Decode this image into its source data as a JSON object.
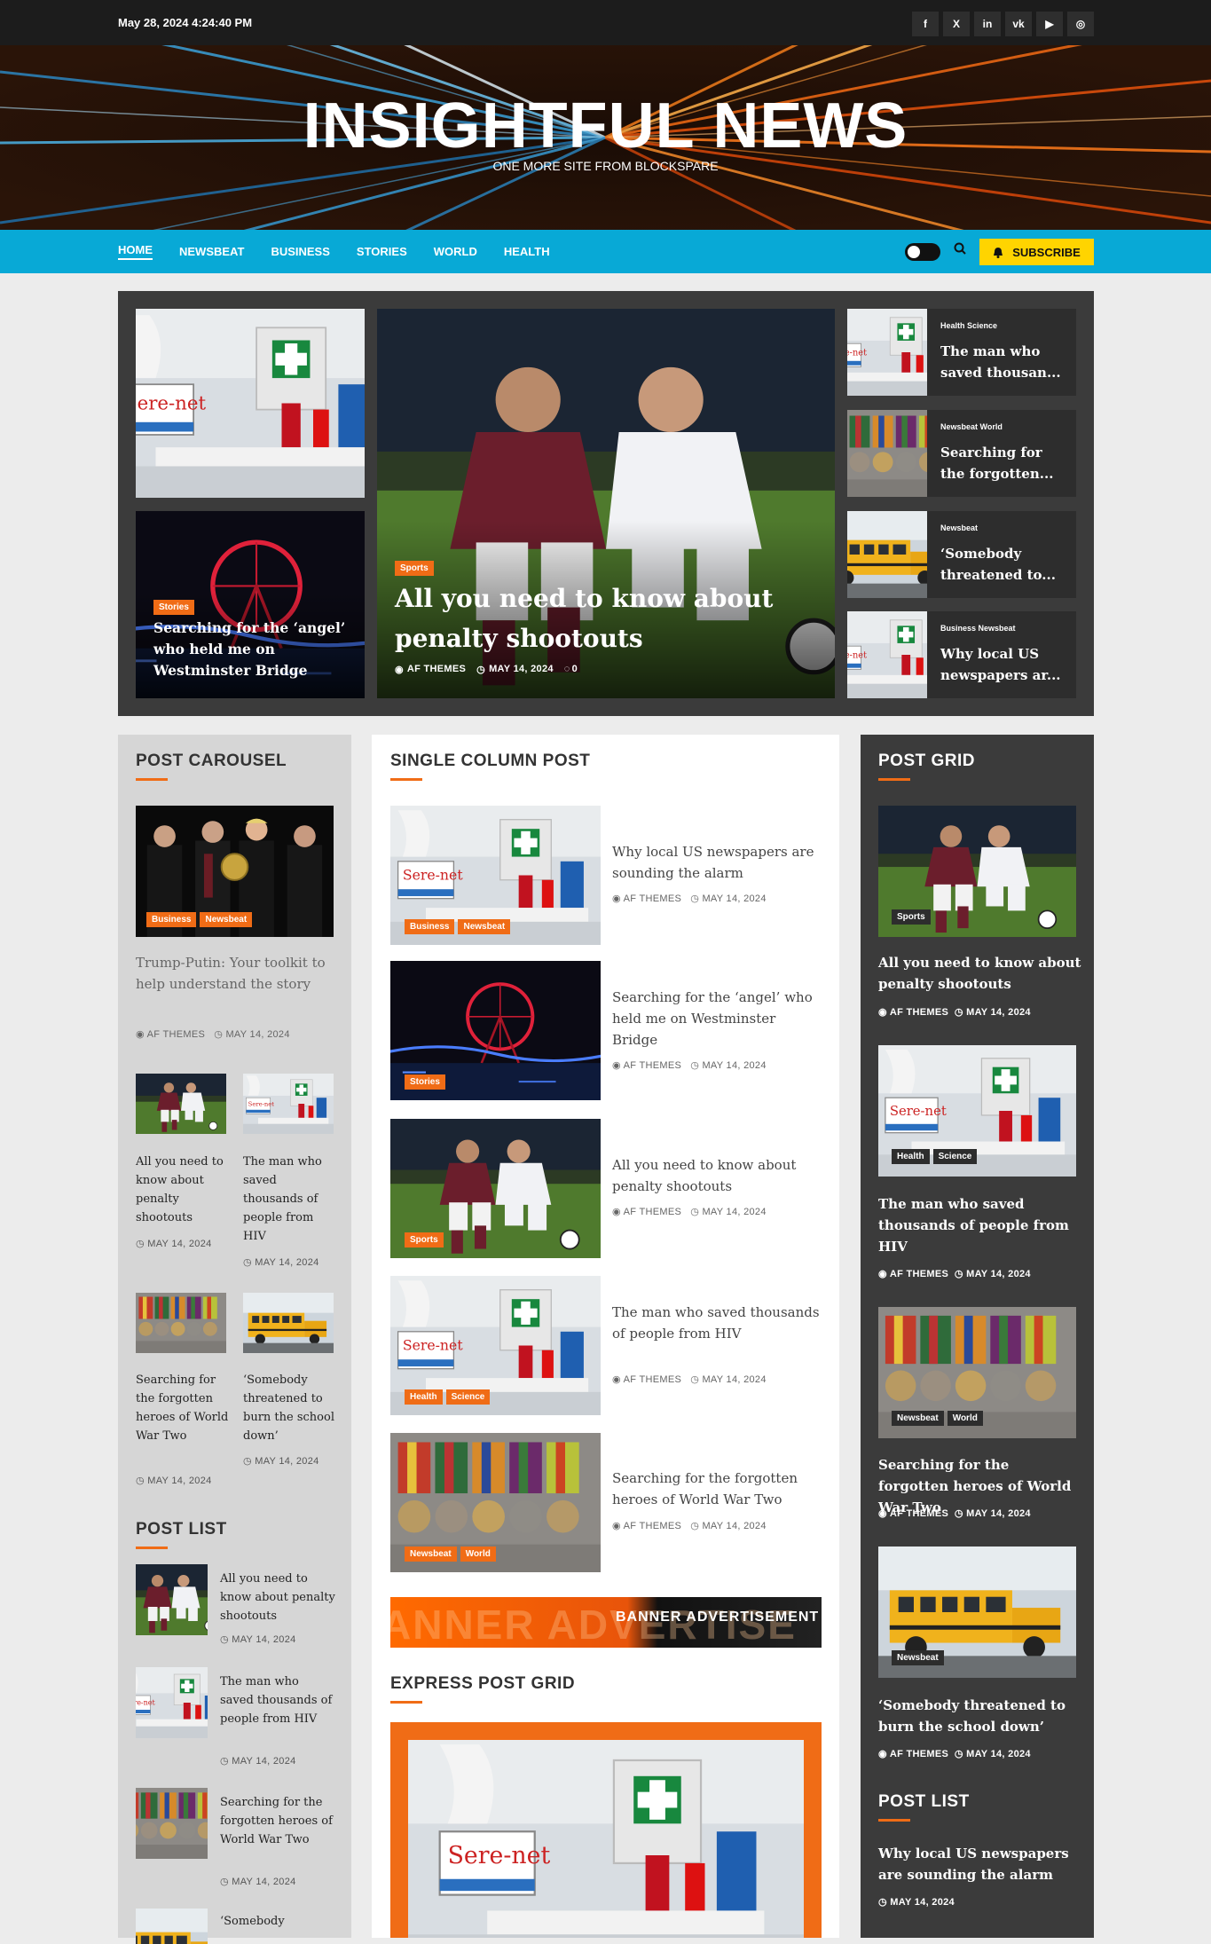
{
  "topbar": {
    "date": "May 28, 2024 4:24:40 PM",
    "social": [
      {
        "icon": "facebook-icon",
        "glyph": "f"
      },
      {
        "icon": "x-icon",
        "glyph": "X"
      },
      {
        "icon": "linkedin-icon",
        "glyph": "in"
      },
      {
        "icon": "vk-icon",
        "glyph": "vk"
      },
      {
        "icon": "youtube-icon",
        "glyph": "▶"
      },
      {
        "icon": "instagram-icon",
        "glyph": "◎"
      }
    ]
  },
  "header": {
    "site_title": "INSIGHTFUL NEWS",
    "tagline": "ONE MORE SITE FROM BLOCKSPARE"
  },
  "nav": {
    "items": [
      "HOME",
      "NEWSBEAT",
      "BUSINESS",
      "STORIES",
      "WORLD",
      "HEALTH"
    ],
    "subscribe": "SUBSCRIBE"
  },
  "colors": {
    "accent": "#f06c16",
    "nav": "#08a9d6",
    "subscribe": "#ffd400",
    "dark": "#3b3b3b"
  },
  "hero": {
    "left_bottom": {
      "cat": "Stories",
      "title": "Searching for the ‘angel’ who held me on Westminster Bridge"
    },
    "main": {
      "cat": "Sports",
      "title": "All you need to know about penalty shootouts",
      "author": "AF THEMES",
      "date": "MAY 14, 2024",
      "comments": "0"
    },
    "side": [
      {
        "cats": "Health  Science",
        "title": "The man who saved thousan..."
      },
      {
        "cats": "Newsbeat  World",
        "title": "Searching for the forgotten..."
      },
      {
        "cats": "Newsbeat",
        "title": "‘Somebody threatened to..."
      },
      {
        "cats": "Business  Newsbeat",
        "title": "Why local US newspapers ar..."
      }
    ]
  },
  "carousel": {
    "heading": "POST CAROUSEL",
    "featured": {
      "cats": [
        "Business",
        "Newsbeat"
      ],
      "title": "Trump-Putin: Your toolkit to help understand the story",
      "author": "AF THEMES",
      "date": "MAY 14, 2024"
    },
    "grid": [
      {
        "title": "All you need to know about penalty shootouts",
        "date": "MAY 14, 2024"
      },
      {
        "title": "The man who saved thousands of people from HIV",
        "date": "MAY 14, 2024"
      },
      {
        "title": "Searching for the forgotten heroes of World War Two",
        "date": "MAY 14, 2024"
      },
      {
        "title": "‘Somebody threatened to burn the school down’",
        "date": "MAY 14, 2024"
      }
    ]
  },
  "post_list_left": {
    "heading": "POST LIST",
    "items": [
      {
        "title": "All you need to know about penalty shootouts",
        "date": "MAY 14, 2024"
      },
      {
        "title": "The man who saved thousands of people from HIV",
        "date": "MAY 14, 2024"
      },
      {
        "title": "Searching for the forgotten heroes of World War Two",
        "date": "MAY 14, 2024"
      },
      {
        "title": "‘Somebody"
      }
    ]
  },
  "single_column": {
    "heading": "SINGLE COLUMN POST",
    "items": [
      {
        "cats": [
          "Business",
          "Newsbeat"
        ],
        "title": "Why local US newspapers are sounding the alarm",
        "author": "AF THEMES",
        "date": "MAY 14, 2024"
      },
      {
        "cats": [
          "Stories"
        ],
        "title": "Searching for the ‘angel’ who held me on Westminster Bridge",
        "author": "AF THEMES",
        "date": "MAY 14, 2024"
      },
      {
        "cats": [
          "Sports"
        ],
        "title": "All you need to know about penalty shootouts",
        "author": "AF THEMES",
        "date": "MAY 14, 2024"
      },
      {
        "cats": [
          "Health",
          "Science"
        ],
        "title": "The man who saved thousands of people from HIV",
        "author": "AF THEMES",
        "date": "MAY 14, 2024"
      },
      {
        "cats": [
          "Newsbeat",
          "World"
        ],
        "title": "Searching for the forgotten heroes of World War Two",
        "author": "AF THEMES",
        "date": "MAY 14, 2024"
      }
    ]
  },
  "ad": {
    "text": "BANNER ADVERTISEMENT",
    "ghost": "ANNER ADVERTISE"
  },
  "express": {
    "heading": "EXPRESS POST GRID"
  },
  "post_grid": {
    "heading": "POST GRID",
    "items": [
      {
        "cats": [
          "Sports"
        ],
        "title": "All you need to know about penalty shootouts",
        "author": "AF THEMES",
        "date": "MAY 14, 2024"
      },
      {
        "cats": [
          "Health",
          "Science"
        ],
        "title": "The man who saved thousands of people from HIV",
        "author": "AF THEMES",
        "date": "MAY 14, 2024"
      },
      {
        "cats": [
          "Newsbeat",
          "World"
        ],
        "title": "Searching for the forgotten heroes of World War Two",
        "author": "AF THEMES",
        "date": "MAY 14, 2024"
      },
      {
        "cats": [
          "Newsbeat"
        ],
        "title": "‘Somebody threatened to burn the school down’",
        "author": "AF THEMES",
        "date": "MAY 14, 2024"
      }
    ]
  },
  "post_list_right": {
    "heading": "POST LIST",
    "items": [
      {
        "title": "Why local US newspapers are sounding the alarm",
        "date": "MAY 14, 2024"
      }
    ]
  }
}
